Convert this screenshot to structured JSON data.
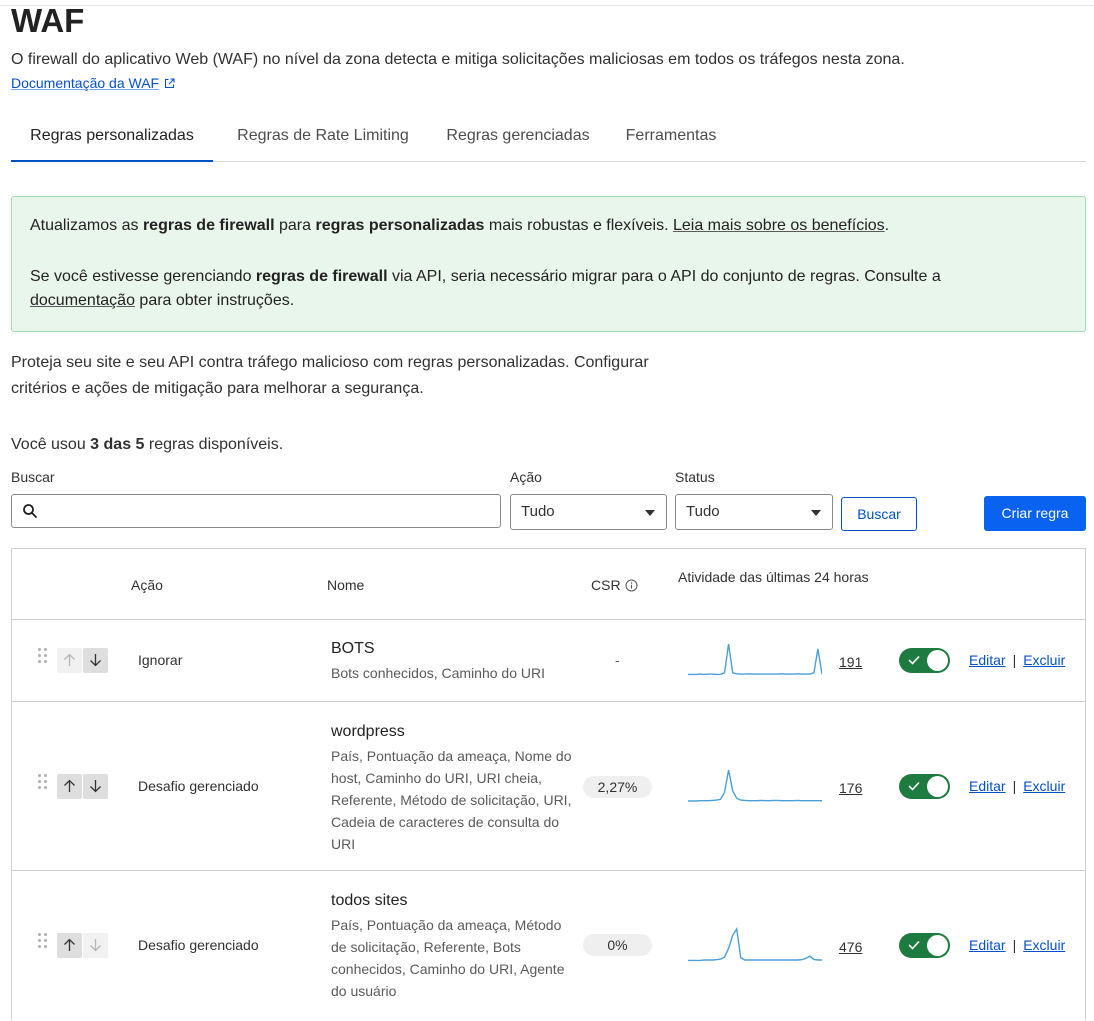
{
  "page": {
    "title": "WAF",
    "description": "O firewall do aplicativo Web (WAF) no nível da zona detecta e mitiga solicitações maliciosas em todos os tráfegos nesta zona.",
    "doc_link": "Documentação da WAF"
  },
  "tabs": [
    {
      "label": "Regras personalizadas",
      "active": true
    },
    {
      "label": "Regras de Rate Limiting",
      "active": false
    },
    {
      "label": "Regras gerenciadas",
      "active": false
    },
    {
      "label": "Ferramentas",
      "active": false
    }
  ],
  "notice": {
    "l1_a": "Atualizamos as ",
    "l1_b": "regras de firewall",
    "l1_c": " para ",
    "l1_d": "regras personalizadas",
    "l1_e": " mais robustas e flexíveis. ",
    "l1_link": "Leia mais sobre os benefícios",
    "l1_f": ".",
    "l2_a": "Se você estivesse gerenciando ",
    "l2_b": "regras de firewall",
    "l2_c": " via API, seria necessário migrar para o API do conjunto de regras. Consulte a",
    "l3_link": "documentação",
    "l3_a": " para obter instruções."
  },
  "intro": "Proteja seu site e seu API contra tráfego malicioso com regras personalizadas. Configurar critérios e ações de mitigação para melhorar a segurança.",
  "usage": {
    "prefix": "Você usou ",
    "bold": "3 das 5",
    "suffix": " regras disponíveis."
  },
  "filters": {
    "search_label": "Buscar",
    "search_value": "",
    "action_label": "Ação",
    "action_value": "Tudo",
    "status_label": "Status",
    "status_value": "Tudo",
    "search_button": "Buscar",
    "create_button": "Criar regra"
  },
  "table": {
    "headers": {
      "action": "Ação",
      "name": "Nome",
      "csr": "CSR",
      "activity": "Atividade das últimas 24 horas"
    },
    "edit_label": "Editar",
    "delete_label": "Excluir",
    "separator": "|",
    "rows": [
      {
        "action": "Ignorar",
        "name": "BOTS",
        "expression": "Bots conhecidos, Caminho do URI",
        "csr": "-",
        "count": "191",
        "enabled": true,
        "spark": [
          0.05,
          0.05,
          0.05,
          0.06,
          0.05,
          0.06,
          0.06,
          0.05,
          0.05,
          0.1,
          1.0,
          0.1,
          0.07,
          0.06,
          0.06,
          0.07,
          0.06,
          0.06,
          0.06,
          0.06,
          0.06,
          0.06,
          0.06,
          0.07,
          0.06,
          0.06,
          0.06,
          0.07,
          0.06,
          0.06,
          0.06,
          0.1,
          0.85,
          0.05
        ]
      },
      {
        "action": "Desafio gerenciado",
        "name": "wordpress",
        "expression": "País, Pontuação da ameaça, Nome do host, Caminho do URI, URI cheia, Referente, Método de solicitação, URI, Cadeia de caracteres de consulta do URI",
        "csr": "2,27%",
        "count": "176",
        "enabled": true,
        "spark": [
          0.03,
          0.03,
          0.03,
          0.04,
          0.04,
          0.04,
          0.05,
          0.06,
          0.08,
          0.3,
          1.0,
          0.35,
          0.12,
          0.06,
          0.05,
          0.04,
          0.04,
          0.04,
          0.05,
          0.04,
          0.04,
          0.05,
          0.05,
          0.04,
          0.04,
          0.04,
          0.04,
          0.05,
          0.04,
          0.04,
          0.04,
          0.04,
          0.04,
          0.04
        ]
      },
      {
        "action": "Desafio gerenciado",
        "name": "todos sites",
        "expression": "País, Pontuação da ameaça, Método de solicitação, Referente, Bots conhecidos, Caminho do URI, Agente do usuário",
        "csr": "0%",
        "count": "476",
        "enabled": true,
        "spark": [
          0.02,
          0.02,
          0.02,
          0.02,
          0.03,
          0.03,
          0.03,
          0.04,
          0.06,
          0.12,
          0.4,
          0.8,
          1.0,
          0.1,
          0.03,
          0.03,
          0.03,
          0.03,
          0.03,
          0.03,
          0.03,
          0.03,
          0.03,
          0.03,
          0.03,
          0.03,
          0.03,
          0.03,
          0.04,
          0.08,
          0.15,
          0.05,
          0.03,
          0.03
        ]
      }
    ]
  },
  "colors": {
    "accent": "#0051c3",
    "primary_button": "#0a62f0",
    "toggle_on": "#1e7b3f",
    "notice_bg": "#e8f6ec",
    "spark": "#4a9fd8"
  }
}
